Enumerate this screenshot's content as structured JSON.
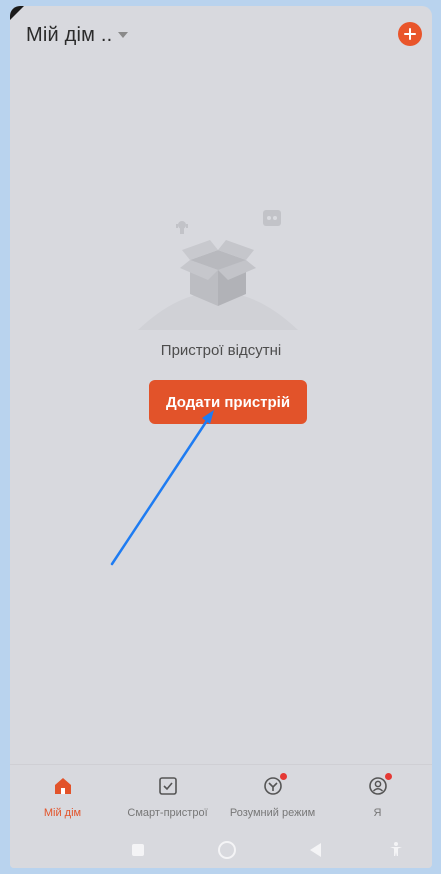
{
  "header": {
    "home_title": "Мій дім ..",
    "caret_icon": "chevron-down-icon",
    "add_icon": "plus-circle-icon",
    "accent_color": "#e2532a"
  },
  "empty_state": {
    "illustration": "empty-box-icon",
    "message": "Пристрої відсутні",
    "button_label": "Додати пристрій"
  },
  "annotation": {
    "arrow_color": "#1e7cf2"
  },
  "bottom_nav": {
    "items": [
      {
        "label": "Мій дім",
        "icon": "home-icon",
        "active": true,
        "badge": false
      },
      {
        "label": "Смарт-пристрої",
        "icon": "checkbox-icon",
        "active": false,
        "badge": false
      },
      {
        "label": "Розумний режим",
        "icon": "scene-icon",
        "active": false,
        "badge": true
      },
      {
        "label": "Я",
        "icon": "profile-icon",
        "active": false,
        "badge": true
      }
    ]
  },
  "system_bar": {
    "buttons": [
      "recent-apps-icon",
      "home-circle-icon",
      "back-triangle-icon",
      "accessibility-icon"
    ]
  }
}
